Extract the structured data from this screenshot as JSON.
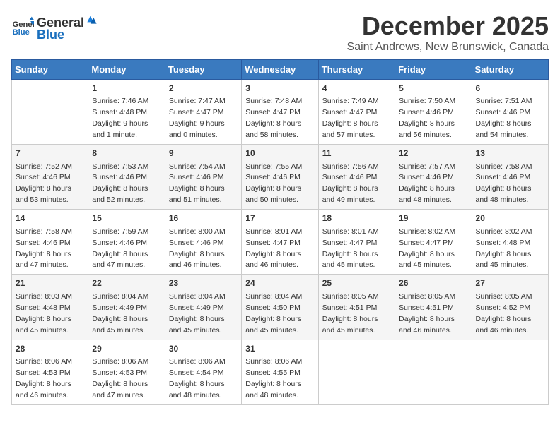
{
  "header": {
    "logo_general": "General",
    "logo_blue": "Blue",
    "title": "December 2025",
    "subtitle": "Saint Andrews, New Brunswick, Canada"
  },
  "days_of_week": [
    "Sunday",
    "Monday",
    "Tuesday",
    "Wednesday",
    "Thursday",
    "Friday",
    "Saturday"
  ],
  "weeks": [
    [
      {
        "day": "",
        "info": ""
      },
      {
        "day": "1",
        "info": "Sunrise: 7:46 AM\nSunset: 4:48 PM\nDaylight: 9 hours\nand 1 minute."
      },
      {
        "day": "2",
        "info": "Sunrise: 7:47 AM\nSunset: 4:47 PM\nDaylight: 9 hours\nand 0 minutes."
      },
      {
        "day": "3",
        "info": "Sunrise: 7:48 AM\nSunset: 4:47 PM\nDaylight: 8 hours\nand 58 minutes."
      },
      {
        "day": "4",
        "info": "Sunrise: 7:49 AM\nSunset: 4:47 PM\nDaylight: 8 hours\nand 57 minutes."
      },
      {
        "day": "5",
        "info": "Sunrise: 7:50 AM\nSunset: 4:46 PM\nDaylight: 8 hours\nand 56 minutes."
      },
      {
        "day": "6",
        "info": "Sunrise: 7:51 AM\nSunset: 4:46 PM\nDaylight: 8 hours\nand 54 minutes."
      }
    ],
    [
      {
        "day": "7",
        "info": "Sunrise: 7:52 AM\nSunset: 4:46 PM\nDaylight: 8 hours\nand 53 minutes."
      },
      {
        "day": "8",
        "info": "Sunrise: 7:53 AM\nSunset: 4:46 PM\nDaylight: 8 hours\nand 52 minutes."
      },
      {
        "day": "9",
        "info": "Sunrise: 7:54 AM\nSunset: 4:46 PM\nDaylight: 8 hours\nand 51 minutes."
      },
      {
        "day": "10",
        "info": "Sunrise: 7:55 AM\nSunset: 4:46 PM\nDaylight: 8 hours\nand 50 minutes."
      },
      {
        "day": "11",
        "info": "Sunrise: 7:56 AM\nSunset: 4:46 PM\nDaylight: 8 hours\nand 49 minutes."
      },
      {
        "day": "12",
        "info": "Sunrise: 7:57 AM\nSunset: 4:46 PM\nDaylight: 8 hours\nand 48 minutes."
      },
      {
        "day": "13",
        "info": "Sunrise: 7:58 AM\nSunset: 4:46 PM\nDaylight: 8 hours\nand 48 minutes."
      }
    ],
    [
      {
        "day": "14",
        "info": "Sunrise: 7:58 AM\nSunset: 4:46 PM\nDaylight: 8 hours\nand 47 minutes."
      },
      {
        "day": "15",
        "info": "Sunrise: 7:59 AM\nSunset: 4:46 PM\nDaylight: 8 hours\nand 47 minutes."
      },
      {
        "day": "16",
        "info": "Sunrise: 8:00 AM\nSunset: 4:46 PM\nDaylight: 8 hours\nand 46 minutes."
      },
      {
        "day": "17",
        "info": "Sunrise: 8:01 AM\nSunset: 4:47 PM\nDaylight: 8 hours\nand 46 minutes."
      },
      {
        "day": "18",
        "info": "Sunrise: 8:01 AM\nSunset: 4:47 PM\nDaylight: 8 hours\nand 45 minutes."
      },
      {
        "day": "19",
        "info": "Sunrise: 8:02 AM\nSunset: 4:47 PM\nDaylight: 8 hours\nand 45 minutes."
      },
      {
        "day": "20",
        "info": "Sunrise: 8:02 AM\nSunset: 4:48 PM\nDaylight: 8 hours\nand 45 minutes."
      }
    ],
    [
      {
        "day": "21",
        "info": "Sunrise: 8:03 AM\nSunset: 4:48 PM\nDaylight: 8 hours\nand 45 minutes."
      },
      {
        "day": "22",
        "info": "Sunrise: 8:04 AM\nSunset: 4:49 PM\nDaylight: 8 hours\nand 45 minutes."
      },
      {
        "day": "23",
        "info": "Sunrise: 8:04 AM\nSunset: 4:49 PM\nDaylight: 8 hours\nand 45 minutes."
      },
      {
        "day": "24",
        "info": "Sunrise: 8:04 AM\nSunset: 4:50 PM\nDaylight: 8 hours\nand 45 minutes."
      },
      {
        "day": "25",
        "info": "Sunrise: 8:05 AM\nSunset: 4:51 PM\nDaylight: 8 hours\nand 45 minutes."
      },
      {
        "day": "26",
        "info": "Sunrise: 8:05 AM\nSunset: 4:51 PM\nDaylight: 8 hours\nand 46 minutes."
      },
      {
        "day": "27",
        "info": "Sunrise: 8:05 AM\nSunset: 4:52 PM\nDaylight: 8 hours\nand 46 minutes."
      }
    ],
    [
      {
        "day": "28",
        "info": "Sunrise: 8:06 AM\nSunset: 4:53 PM\nDaylight: 8 hours\nand 46 minutes."
      },
      {
        "day": "29",
        "info": "Sunrise: 8:06 AM\nSunset: 4:53 PM\nDaylight: 8 hours\nand 47 minutes."
      },
      {
        "day": "30",
        "info": "Sunrise: 8:06 AM\nSunset: 4:54 PM\nDaylight: 8 hours\nand 48 minutes."
      },
      {
        "day": "31",
        "info": "Sunrise: 8:06 AM\nSunset: 4:55 PM\nDaylight: 8 hours\nand 48 minutes."
      },
      {
        "day": "",
        "info": ""
      },
      {
        "day": "",
        "info": ""
      },
      {
        "day": "",
        "info": ""
      }
    ]
  ]
}
